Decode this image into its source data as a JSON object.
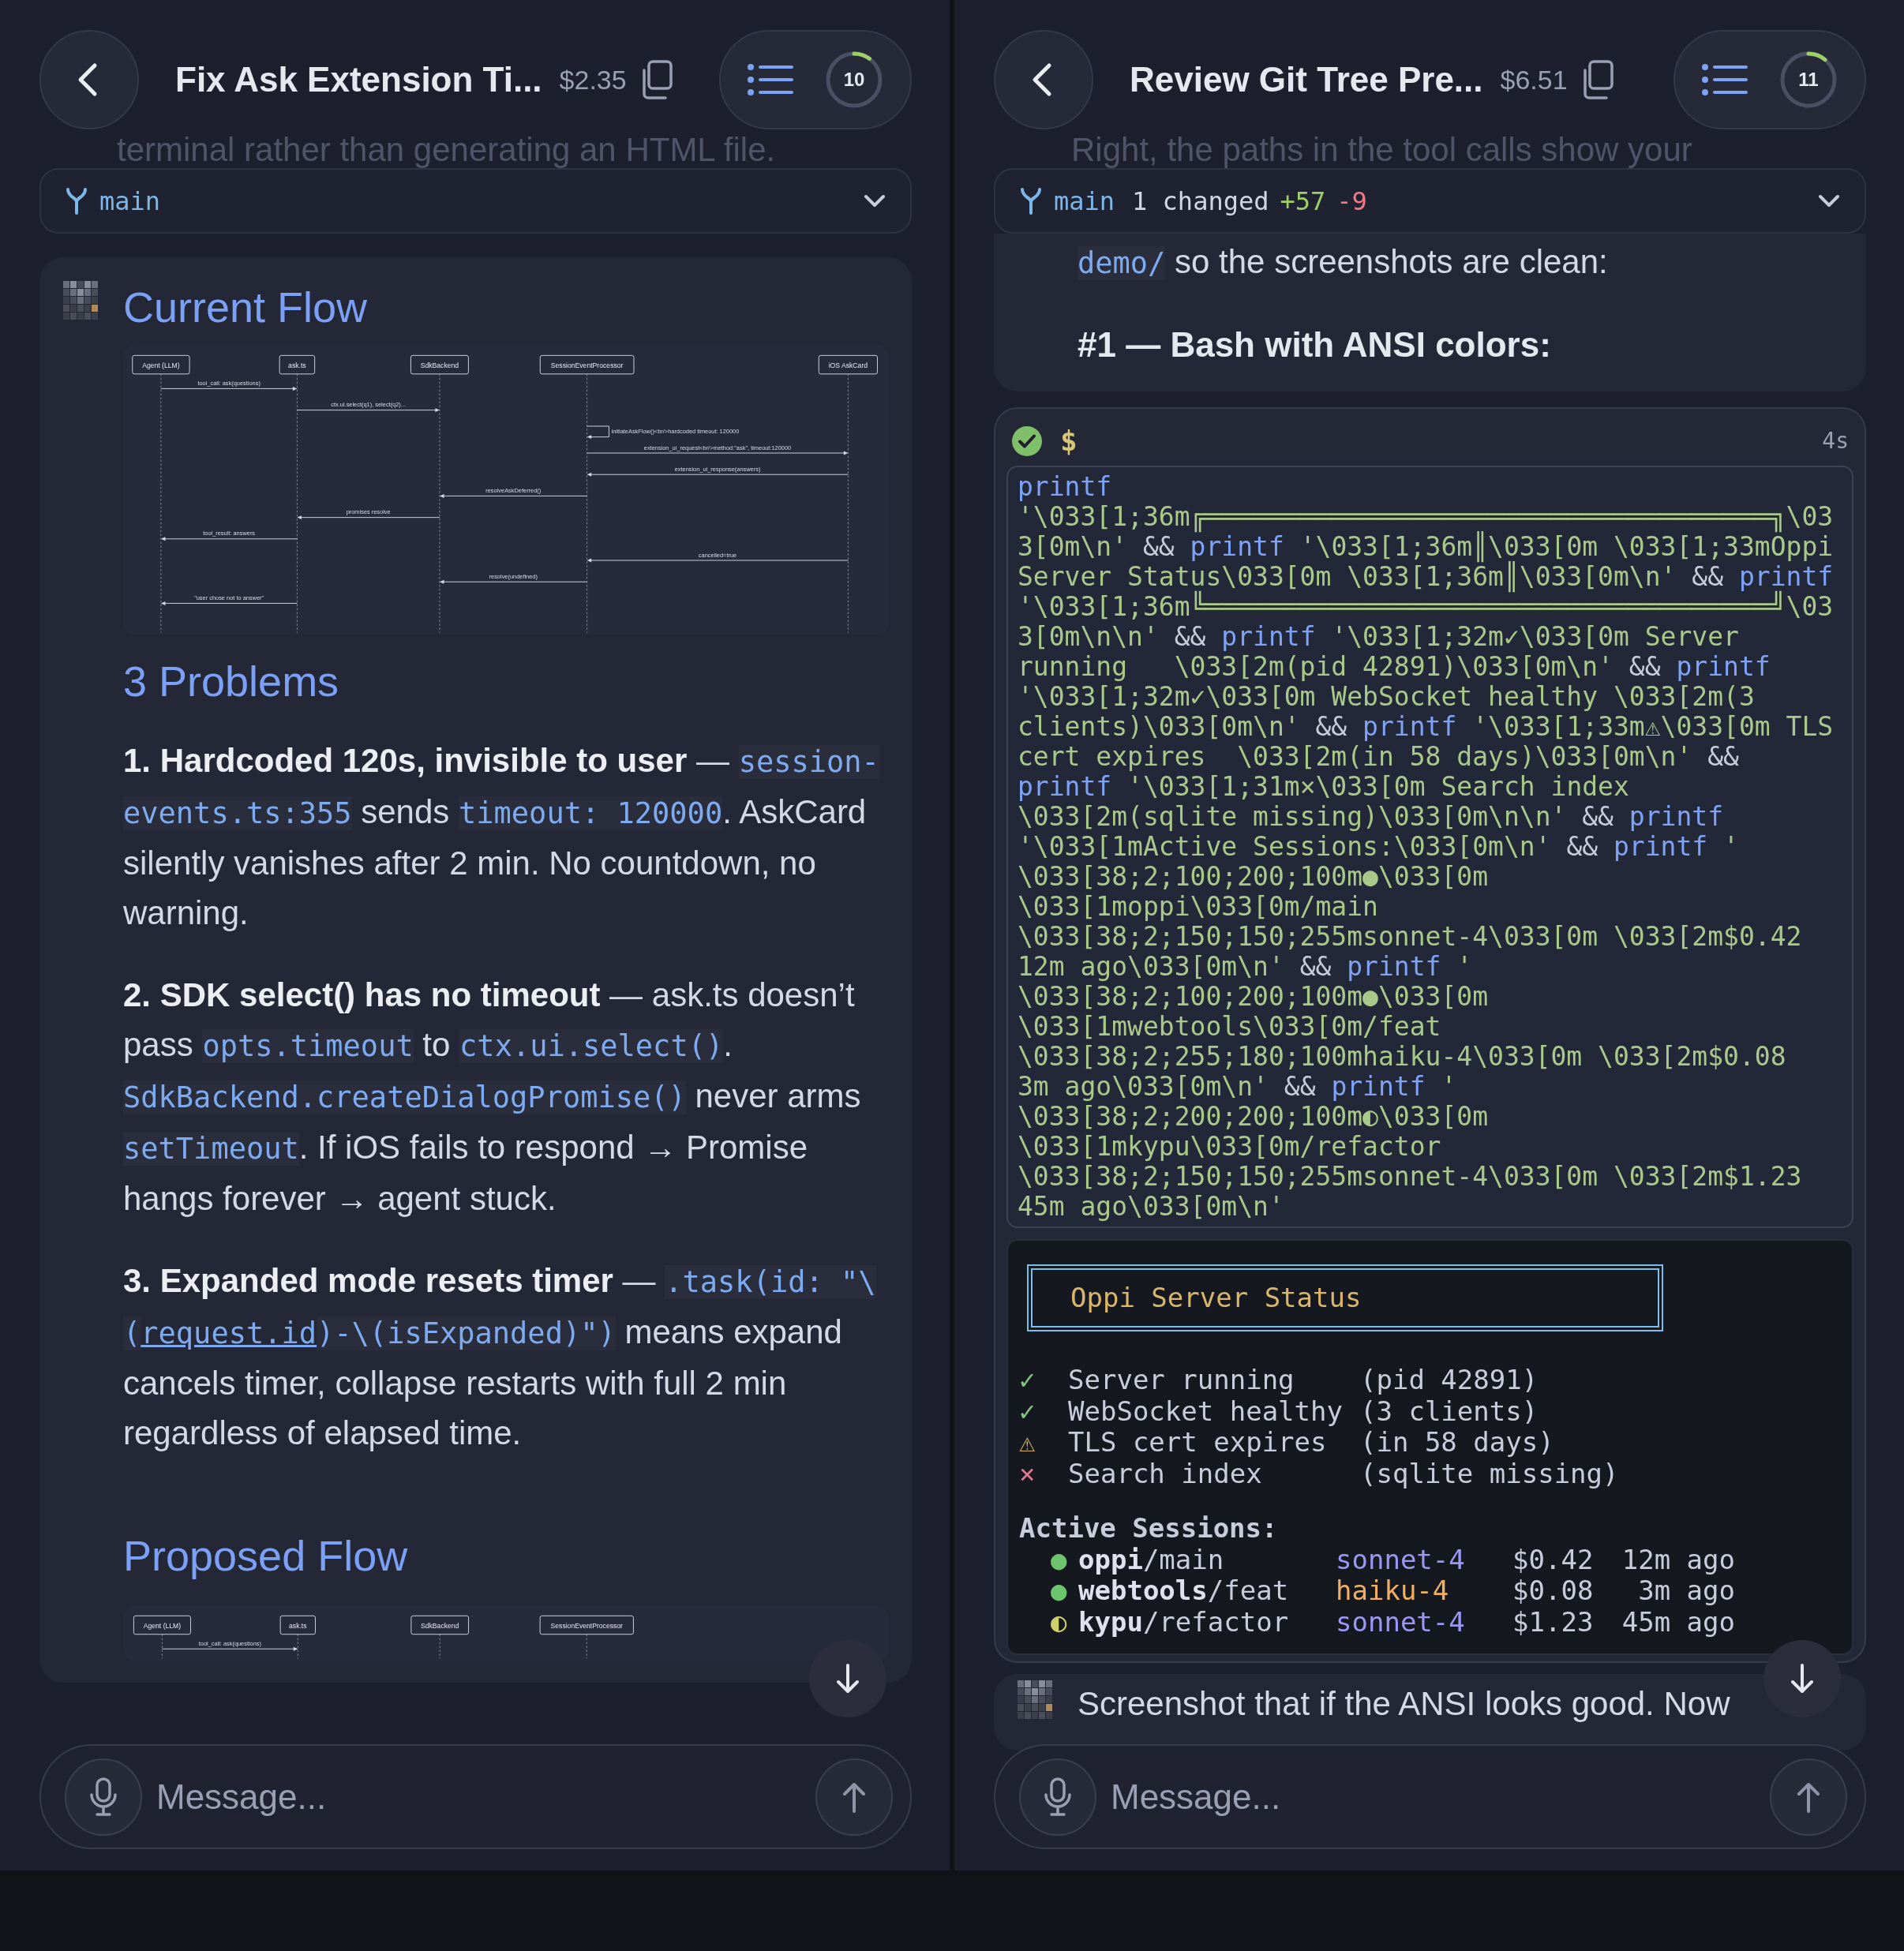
{
  "sessions": [
    {
      "title": "Fix Ask Extension Ti...",
      "cost": "$2.35",
      "context": {
        "label": "10",
        "level": 0.1
      },
      "backdrop_text": "terminal rather than generating an HTML file.",
      "branch": {
        "name": "main"
      },
      "cards": [
        {
          "kind": "message",
          "avatar": true,
          "blocks": [
            {
              "kind": "title",
              "text": "Current Flow"
            },
            {
              "kind": "diagram",
              "participants": [
                "Agent (LLM)",
                "ask.ts",
                "SdkBackend",
                "SessionEventProcessor",
                "iOS AskCard"
              ],
              "messages": [
                {
                  "kind": "p0p1",
                  "label": "tool_call: ask(questions)"
                },
                {
                  "kind": "p1p2",
                  "label": "ctx.ui.select(q1), select(q2)..."
                },
                {
                  "kind": "p3p3",
                  "label": "initiateAskFlow()<br/>hardcoded timeout: 120000"
                },
                {
                  "kind": "p3p4",
                  "label": "extension_ui_request<br/>method:\"ask\", timeout:120000"
                },
                {
                  "kind": "p4p3",
                  "label": "extension_ui_response(answers)"
                },
                {
                  "kind": "p3p2",
                  "label": "resolveAskDeferred()"
                },
                {
                  "kind": "p2p1",
                  "label": "promises resolve"
                },
                {
                  "kind": "p1p0",
                  "label": "tool_result: answers"
                },
                {
                  "kind": "p4p3",
                  "label": "cancelled=true"
                },
                {
                  "kind": "p3p2",
                  "label": "resolve(undefined)"
                },
                {
                  "kind": "p1p0",
                  "label": "\"user chose not to answer\""
                }
              ]
            },
            {
              "kind": "title",
              "text": "3 Problems"
            },
            {
              "kind": "rich",
              "segments": [
                {
                  "kind": "bold",
                  "text": "1. Hardcoded 120s, invisible to user"
                },
                {
                  "kind": "text",
                  "text": " — "
                },
                {
                  "kind": "code",
                  "text": "session-events.ts:355"
                },
                {
                  "kind": "text",
                  "text": " sends "
                },
                {
                  "kind": "code",
                  "text": "timeout: 120000"
                },
                {
                  "kind": "text",
                  "text": ". AskCard silently vanishes after 2 min. No countdown, no warning."
                }
              ]
            },
            {
              "kind": "rich",
              "segments": [
                {
                  "kind": "bold",
                  "text": "2. SDK select() has no timeout"
                },
                {
                  "kind": "text",
                  "text": " — ask.ts doesn’t pass "
                },
                {
                  "kind": "code",
                  "text": "opts.timeout"
                },
                {
                  "kind": "text",
                  "text": " to "
                },
                {
                  "kind": "code",
                  "text": "ctx.ui.select()"
                },
                {
                  "kind": "text",
                  "text": ". "
                },
                {
                  "kind": "code",
                  "text": "SdkBackend.createDialogPromise()"
                },
                {
                  "kind": "text",
                  "text": " never arms "
                },
                {
                  "kind": "code",
                  "text": "setTimeout"
                },
                {
                  "kind": "text",
                  "text": ". If iOS fails to respond → Promise hangs forever → agent stuck."
                }
              ]
            },
            {
              "kind": "rich",
              "segments": [
                {
                  "kind": "bold",
                  "text": "3. Expanded mode resets timer"
                },
                {
                  "kind": "text",
                  "text": " — "
                },
                {
                  "kind": "code",
                  "text": ".task(id: \"\\("
                },
                {
                  "kind": "link",
                  "text": "request.id"
                },
                {
                  "kind": "code",
                  "text": ")-\\(isExpanded)\")"
                },
                {
                  "kind": "text",
                  "text": " means expand cancels timer, collapse restarts with full 2 min regardless of elapsed time."
                }
              ]
            },
            {
              "kind": "title",
              "text": "Proposed Flow"
            },
            {
              "kind": "diagram",
              "participants": [
                "Agent (LLM)",
                "ask.ts",
                "SdkBackend",
                "SessionEventProcessor"
              ],
              "messages": [
                {
                  "kind": "p0p1",
                  "label": "tool_call: ask(questions)"
                }
              ]
            }
          ]
        }
      ],
      "composer": {
        "placeholder": "Message..."
      }
    },
    {
      "title": "Review Git Tree Pre...",
      "cost": "$6.51",
      "context": {
        "label": "11",
        "level": 0.11
      },
      "backdrop_text": "Right, the paths in the tool calls show your",
      "branch": {
        "name": "main",
        "changes": "1 changed",
        "added": "+57",
        "removed": "-9"
      },
      "cards": [
        {
          "kind": "message",
          "blocks": [
            {
              "kind": "rich",
              "segments": [
                {
                  "kind": "code",
                  "text": "demo/"
                },
                {
                  "kind": "text",
                  "text": " so the screenshots are clean:"
                }
              ]
            },
            {
              "kind": "strong",
              "text": "#1 — Bash with ANSI colors:"
            }
          ]
        },
        {
          "kind": "tool_call",
          "succeeded": true,
          "prompt": "$",
          "duration": "4s",
          "command": [
            {
              "kind": "keyword",
              "text": "printf"
            },
            {
              "kind": "string",
              "text": " '\\033[1;36m╔════════════════════════════════════╗\\033[0m\\n'"
            },
            {
              "kind": "operator",
              "text": " && "
            },
            {
              "kind": "keyword",
              "text": "printf"
            },
            {
              "kind": "string",
              "text": " '\\033[1;36m║\\033[0m \\033[1;33mOppi Server Status\\033[0m \\033[1;36m║\\033[0m\\n'"
            },
            {
              "kind": "operator",
              "text": " && "
            },
            {
              "kind": "keyword",
              "text": "printf"
            },
            {
              "kind": "string",
              "text": " '\\033[1;36m╚════════════════════════════════════╝\\033[0m\\n\\n'"
            },
            {
              "kind": "operator",
              "text": " && "
            },
            {
              "kind": "keyword",
              "text": "printf"
            },
            {
              "kind": "string",
              "text": " '\\033[1;32m✓\\033[0m Server running   \\033[2m(pid 42891)\\033[0m\\n'"
            },
            {
              "kind": "operator",
              "text": " && "
            },
            {
              "kind": "keyword",
              "text": "printf"
            },
            {
              "kind": "string",
              "text": " '\\033[1;32m✓\\033[0m WebSocket healthy \\033[2m(3 clients)\\033[0m\\n'"
            },
            {
              "kind": "operator",
              "text": " && "
            },
            {
              "kind": "keyword",
              "text": "printf"
            },
            {
              "kind": "string",
              "text": " '\\033[1;33m⚠\\033[0m TLS cert expires  \\033[2m(in 58 days)\\033[0m\\n'"
            },
            {
              "kind": "operator",
              "text": " && "
            },
            {
              "kind": "keyword",
              "text": "printf"
            },
            {
              "kind": "string",
              "text": " '\\033[1;31m×\\033[0m Search index \\033[2m(sqlite missing)\\033[0m\\n\\n'"
            },
            {
              "kind": "operator",
              "text": " && "
            },
            {
              "kind": "keyword",
              "text": "printf"
            },
            {
              "kind": "string",
              "text": " '\\033[1mActive Sessions:\\033[0m\\n'"
            },
            {
              "kind": "operator",
              "text": " && "
            },
            {
              "kind": "keyword",
              "text": "printf"
            },
            {
              "kind": "string",
              "text": " ' \\033[38;2;100;200;100m●\\033[0m \\033[1moppi\\033[0m/main \\033[38;2;150;150;255msonnet-4\\033[0m \\033[2m$0.42  12m ago\\033[0m\\n'"
            },
            {
              "kind": "operator",
              "text": " && "
            },
            {
              "kind": "keyword",
              "text": "printf"
            },
            {
              "kind": "string",
              "text": " ' \\033[38;2;100;200;100m●\\033[0m \\033[1mwebtools\\033[0m/feat \\033[38;2;255;180;100mhaiku-4\\033[0m \\033[2m$0.08   3m ago\\033[0m\\n'"
            },
            {
              "kind": "operator",
              "text": " && "
            },
            {
              "kind": "keyword",
              "text": "printf"
            },
            {
              "kind": "string",
              "text": " ' \\033[38;2;200;200;100m◐\\033[0m \\033[1mkypu\\033[0m/refactor   \\033[38;2;150;150;255msonnet-4\\033[0m \\033[2m$1.23  45m ago\\033[0m\\n'"
            }
          ],
          "output": {
            "banner": "Oppi Server Status",
            "checks": [
              {
                "kind": "ok",
                "symbol": "✓",
                "label": "Server running",
                "detail": "(pid 42891)"
              },
              {
                "kind": "ok",
                "symbol": "✓",
                "label": "WebSocket healthy",
                "detail": "(3 clients)"
              },
              {
                "kind": "warn",
                "symbol": "⚠",
                "label": "TLS cert expires",
                "detail": "(in 58 days)"
              },
              {
                "kind": "error",
                "symbol": "×",
                "label": "Search index",
                "detail": "(sqlite missing)"
              }
            ],
            "sessions_heading": "Active Sessions:",
            "sessions": [
              {
                "symbol": "●",
                "color": "#6cc46c",
                "project": "oppi",
                "branch": "/main",
                "model": {
                  "text": "sonnet-4",
                  "color": "#9a97f5"
                },
                "cost": "$0.42",
                "age": "12m ago"
              },
              {
                "symbol": "●",
                "color": "#6cc46c",
                "project": "webtools",
                "branch": "/feat",
                "model": {
                  "text": "haiku-4",
                  "color": "#f0b064"
                },
                "cost": "$0.08",
                "age": "3m ago"
              },
              {
                "symbol": "◐",
                "color": "#cfcf6e",
                "project": "kypu",
                "branch": "/refactor",
                "model": {
                  "text": "sonnet-4",
                  "color": "#9a97f5"
                },
                "cost": "$1.23",
                "age": "45m ago"
              }
            ]
          }
        },
        {
          "kind": "message",
          "avatar": true,
          "blocks": [
            {
              "kind": "rich",
              "segments": [
                {
                  "kind": "text",
                  "text": "Screenshot that if the ANSI looks good. Now"
                }
              ]
            }
          ]
        }
      ],
      "composer": {
        "placeholder": "Message..."
      }
    }
  ]
}
